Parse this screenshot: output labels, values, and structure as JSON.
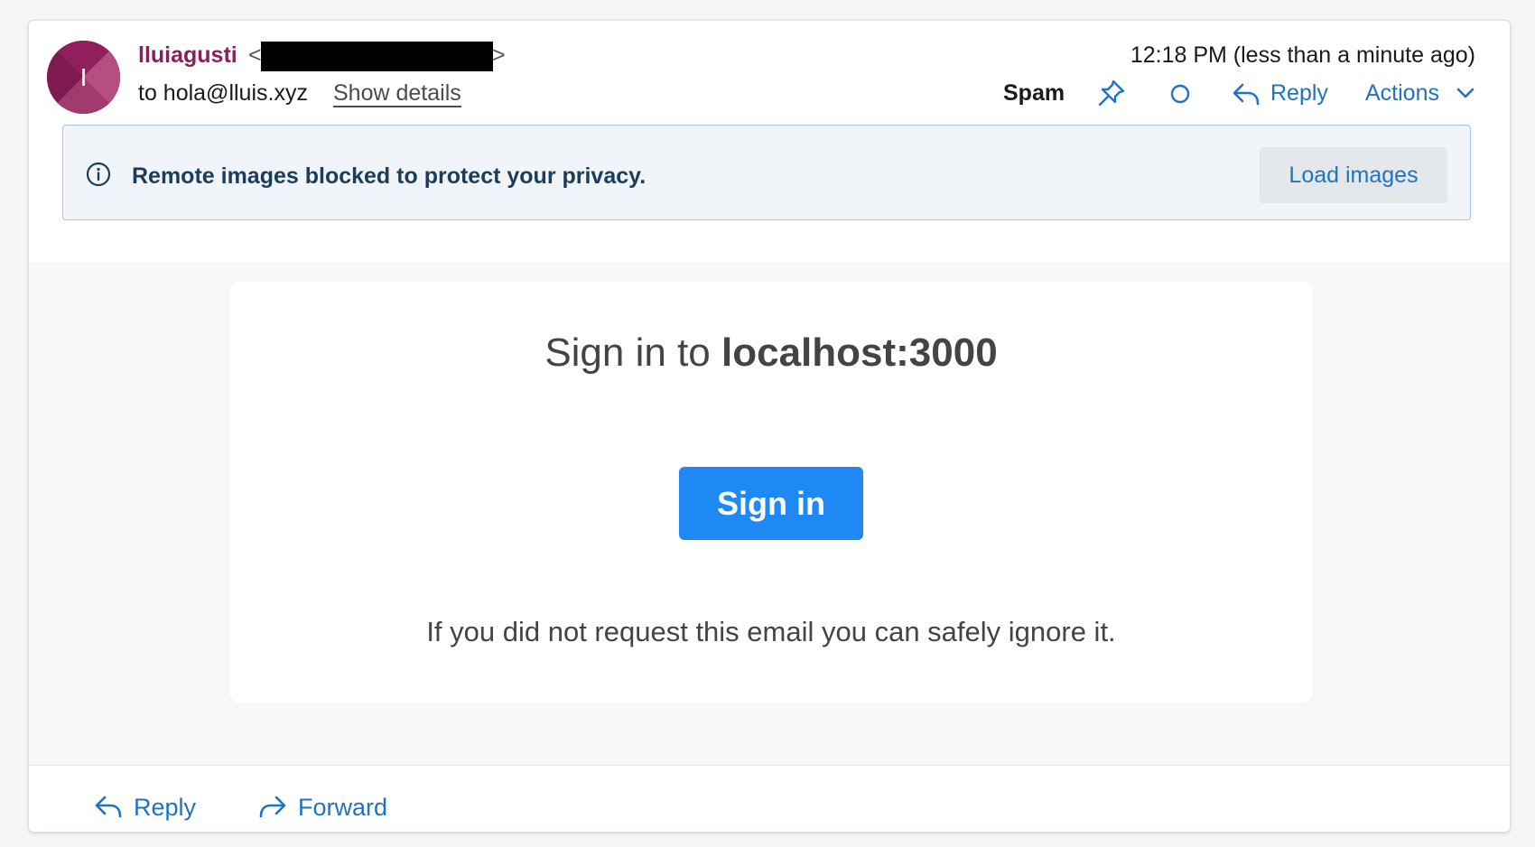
{
  "sender": {
    "avatar_letter": "I",
    "name": "lluiagusti",
    "email_open": "<",
    "email_close": ">",
    "to_line": "to hola@lluis.xyz",
    "show_details": "Show details"
  },
  "header": {
    "timestamp": "12:18 PM (less than a minute ago)",
    "spam_label": "Spam",
    "reply_label": "Reply",
    "actions_label": "Actions"
  },
  "notice": {
    "text": "Remote images blocked to protect your privacy.",
    "load_images_label": "Load images"
  },
  "email": {
    "heading_prefix": "Sign in to ",
    "heading_host": "localhost:3000",
    "signin_label": "Sign in",
    "note": "If you did not request this email you can safely ignore it."
  },
  "footer": {
    "reply_label": "Reply",
    "forward_label": "Forward"
  },
  "colors": {
    "accent": "#1f73c0",
    "sender": "#8b1f5a",
    "signin_button": "#1e88f5"
  },
  "icons": [
    "pin-icon",
    "circle-icon",
    "reply-icon",
    "chevron-down-icon",
    "info-icon",
    "forward-icon"
  ]
}
